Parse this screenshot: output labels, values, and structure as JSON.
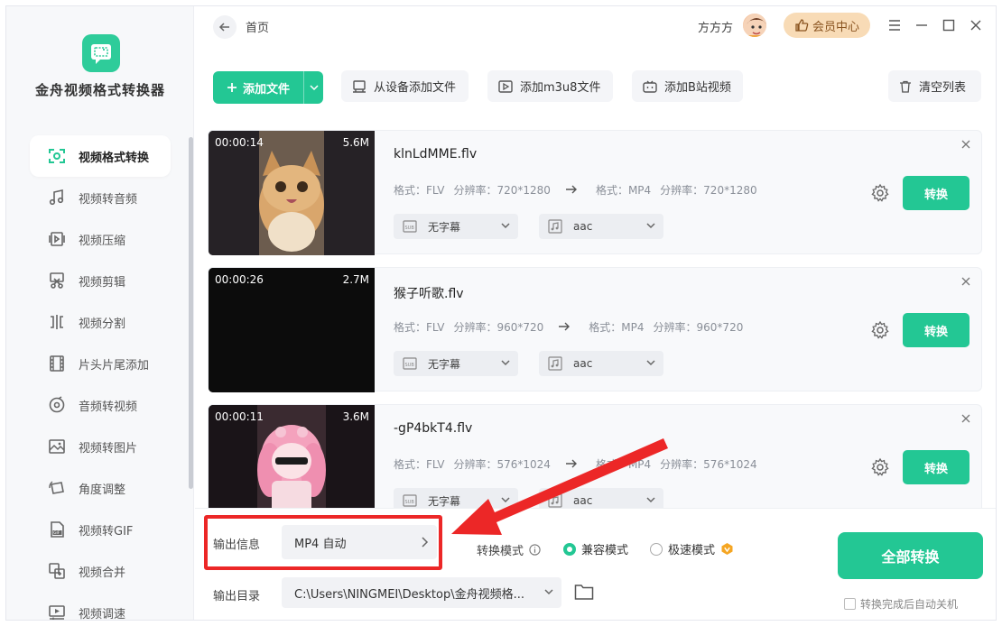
{
  "app": {
    "name": "金舟视频格式转换器",
    "accent_color": "#23c794"
  },
  "sidebar": {
    "items": [
      {
        "label": "视频格式转换",
        "icon": "format-convert-icon",
        "active": true
      },
      {
        "label": "视频转音频",
        "icon": "music-note-icon",
        "active": false
      },
      {
        "label": "视频压缩",
        "icon": "compress-icon",
        "active": false
      },
      {
        "label": "视频剪辑",
        "icon": "scissors-icon",
        "active": false
      },
      {
        "label": "视频分割",
        "icon": "split-icon",
        "active": false
      },
      {
        "label": "片头片尾添加",
        "icon": "film-strip-icon",
        "active": false
      },
      {
        "label": "音频转视频",
        "icon": "disc-icon",
        "active": false
      },
      {
        "label": "视频转图片",
        "icon": "image-icon",
        "active": false
      },
      {
        "label": "角度调整",
        "icon": "rotate-icon",
        "active": false
      },
      {
        "label": "视频转GIF",
        "icon": "gif-icon",
        "active": false
      },
      {
        "label": "视频合并",
        "icon": "merge-icon",
        "active": false
      },
      {
        "label": "视频调速",
        "icon": "speed-icon",
        "active": false
      }
    ]
  },
  "header": {
    "breadcrumb": "首页",
    "user_name": "方方方",
    "vip_label": "会员中心"
  },
  "toolbar": {
    "add_file": "添加文件",
    "add_from_device": "从设备添加文件",
    "add_m3u8": "添加m3u8文件",
    "add_bilibili": "添加B站视频",
    "clear_list": "清空列表"
  },
  "files": [
    {
      "duration": "00:00:14",
      "size": "5.6M",
      "name": "klnLdMME.flv",
      "src_format_label": "格式：FLV",
      "src_res_label": "分辨率：720*1280",
      "dst_format_label": "格式：MP4",
      "dst_res_label": "分辨率：720*1280",
      "subtitle": "无字幕",
      "audio": "aac",
      "convert": "转换"
    },
    {
      "duration": "00:00:26",
      "size": "2.7M",
      "name": "猴子听歌.flv",
      "src_format_label": "格式：FLV",
      "src_res_label": "分辨率：960*720",
      "dst_format_label": "格式：MP4",
      "dst_res_label": "分辨率：960*720",
      "subtitle": "无字幕",
      "audio": "aac",
      "convert": "转换"
    },
    {
      "duration": "00:00:11",
      "size": "3.6M",
      "name": "-gP4bkT4.flv",
      "src_format_label": "格式：FLV",
      "src_res_label": "分辨率：576*1024",
      "dst_format_label": "格式：MP4",
      "dst_res_label": "分辨率：576*1024",
      "subtitle": "无字幕",
      "audio": "aac",
      "convert": "转换"
    }
  ],
  "bottom": {
    "output_info_label": "输出信息",
    "output_format": "MP4 自动",
    "mode_label": "转换模式",
    "mode_compatible": "兼容模式",
    "mode_fast": "极速模式",
    "selected_mode": "兼容模式",
    "output_dir_label": "输出目录",
    "output_dir": "C:\\Users\\NINGMEI\\Desktop\\金舟视频格...",
    "convert_all": "全部转换",
    "auto_shutdown": "转换完成后自动关机"
  },
  "annotation_color": "#ec2727"
}
